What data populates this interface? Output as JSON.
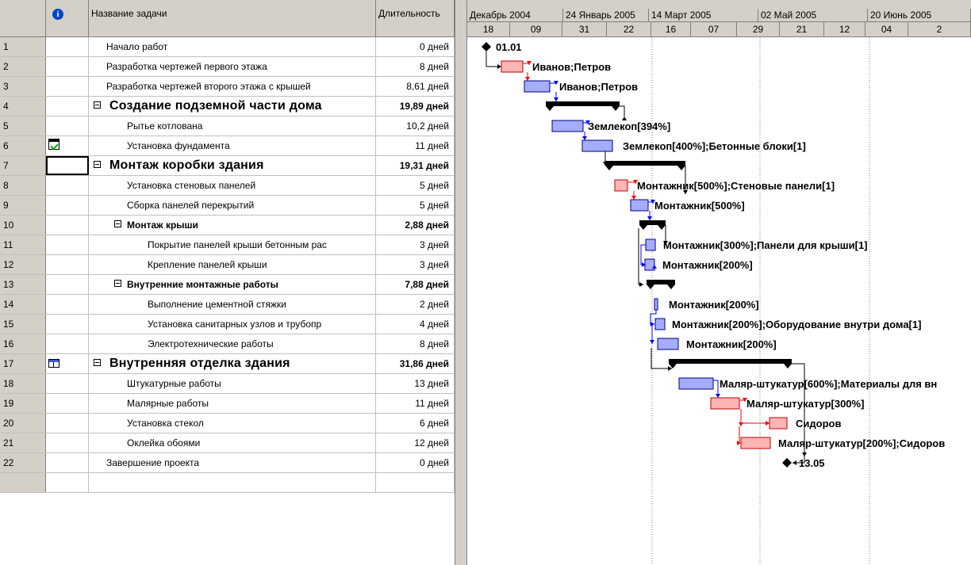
{
  "table": {
    "headers": {
      "indicators_icon": "info-icon",
      "name": "Название задачи",
      "duration": "Длительность"
    },
    "rows": [
      {
        "id": "1",
        "name": "Начало работ",
        "duration": "0 дней",
        "level": 1,
        "type": "milestone",
        "icon": ""
      },
      {
        "id": "2",
        "name": "Разработка чертежей первого этажа",
        "duration": "8 дней",
        "level": 1,
        "type": "task",
        "icon": ""
      },
      {
        "id": "3",
        "name": "Разработка чертежей второго этажа с крышей",
        "duration": "8,61 дней",
        "level": 1,
        "type": "task",
        "icon": ""
      },
      {
        "id": "4",
        "name": "Создание подземной части дома",
        "duration": "19,89 дней",
        "level": 1,
        "type": "summary-big",
        "icon": ""
      },
      {
        "id": "5",
        "name": "Рытье котлована",
        "duration": "10,2 дней",
        "level": 2,
        "type": "task",
        "icon": ""
      },
      {
        "id": "6",
        "name": "Установка фундамента",
        "duration": "11 дней",
        "level": 2,
        "type": "task",
        "icon": "constraint-calendar-icon"
      },
      {
        "id": "7",
        "name": "Монтаж коробки здания",
        "duration": "19,31 дней",
        "level": 1,
        "type": "summary-big",
        "icon": ""
      },
      {
        "id": "8",
        "name": "Установка стеновых панелей",
        "duration": "5 дней",
        "level": 2,
        "type": "task",
        "icon": ""
      },
      {
        "id": "9",
        "name": "Сборка панелей перекрытий",
        "duration": "5 дней",
        "level": 2,
        "type": "task",
        "icon": ""
      },
      {
        "id": "10",
        "name": "Монтаж крыши",
        "duration": "2,88 дней",
        "level": 2,
        "type": "summary",
        "icon": ""
      },
      {
        "id": "11",
        "name": "Покрытие панелей крыши бетонным рас",
        "duration": "3 дней",
        "level": 3,
        "type": "task",
        "icon": ""
      },
      {
        "id": "12",
        "name": "Крепление панелей крыши",
        "duration": "3 дней",
        "level": 3,
        "type": "task",
        "icon": ""
      },
      {
        "id": "13",
        "name": "Внутренние монтажные работы",
        "duration": "7,88 дней",
        "level": 2,
        "type": "summary",
        "icon": ""
      },
      {
        "id": "14",
        "name": "Выполнение цементной стяжки",
        "duration": "2 дней",
        "level": 3,
        "type": "task",
        "icon": ""
      },
      {
        "id": "15",
        "name": "Установка санитарных узлов и трубопр",
        "duration": "4 дней",
        "level": 3,
        "type": "task",
        "icon": ""
      },
      {
        "id": "16",
        "name": "Электротехнические работы",
        "duration": "8 дней",
        "level": 3,
        "type": "task",
        "icon": ""
      },
      {
        "id": "17",
        "name": "Внутренняя отделка здания",
        "duration": "31,86 дней",
        "level": 1,
        "type": "summary-big",
        "icon": "table-icon"
      },
      {
        "id": "18",
        "name": "Штукатурные работы",
        "duration": "13 дней",
        "level": 2,
        "type": "task",
        "icon": ""
      },
      {
        "id": "19",
        "name": "Малярные работы",
        "duration": "11 дней",
        "level": 2,
        "type": "task",
        "icon": ""
      },
      {
        "id": "20",
        "name": "Установка стекол",
        "duration": "6 дней",
        "level": 2,
        "type": "task",
        "icon": ""
      },
      {
        "id": "21",
        "name": "Оклейка обоями",
        "duration": "12 дней",
        "level": 2,
        "type": "task",
        "icon": ""
      },
      {
        "id": "22",
        "name": "Завершение проекта",
        "duration": "0 дней",
        "level": 1,
        "type": "milestone",
        "icon": ""
      }
    ]
  },
  "timescale": {
    "major": [
      "Декабрь 2004",
      "24 Январь 2005",
      "14 Март 2005",
      "02 Май 2005",
      "20 Июнь 2005"
    ],
    "minor": [
      "18",
      "09",
      "31",
      "22",
      "16",
      "07",
      "29",
      "21",
      "12",
      "04",
      "2"
    ]
  },
  "gantt": {
    "labels": {
      "r1": "01.01",
      "r2": "Иванов;Петров",
      "r3": "Иванов;Петров",
      "r5": "Землекоп[394%]",
      "r6": "Землекоп[400%];Бетонные блоки[1]",
      "r8": "Монтажник[500%];Стеновые панели[1]",
      "r9": "Монтажник[500%]",
      "r11": "Монтажник[300%];Панели для крыши[1]",
      "r12": "Монтажник[200%]",
      "r14": "Монтажник[200%]",
      "r15": "Монтажник[200%];Оборудование внутри дома[1]",
      "r16": "Монтажник[200%]",
      "r18": "Маляр-штукатур[600%];Материалы для вн",
      "r19": "Маляр-штукатур[300%]",
      "r20": "Сидоров",
      "r21": "Маляр-штукатур[200%];Сидоров",
      "r22": "13.05"
    },
    "colors": {
      "critical": "#ff6a6a",
      "normal": "#4a5aff",
      "summary": "#000000",
      "link_red": "#ff0000",
      "link_blue": "#0000ff"
    }
  }
}
